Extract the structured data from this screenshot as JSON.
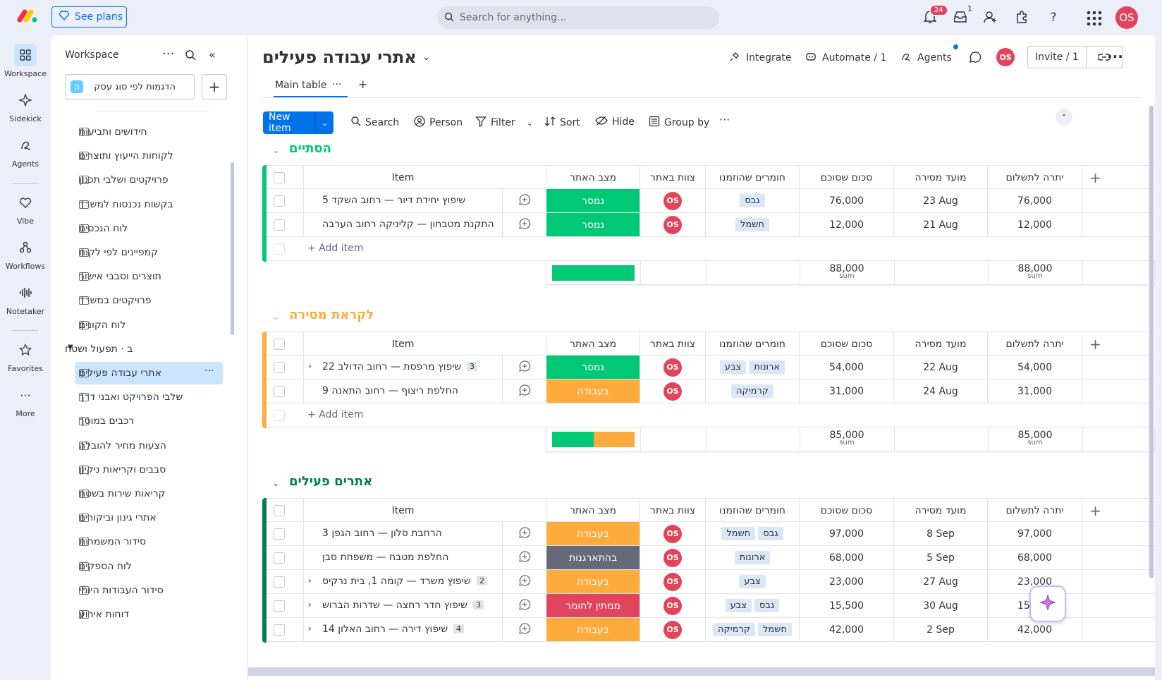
{
  "topbar": {
    "see_plans": "See plans",
    "search_placeholder": "Search for anything...",
    "notifications_count": "24",
    "inbox_count": "1",
    "user_initials": "OS"
  },
  "rail": [
    {
      "label": "Workspace",
      "icon": "grid-icon"
    },
    {
      "label": "Sidekick",
      "icon": "sparkle-icon"
    },
    {
      "label": "Agents",
      "icon": "agents-icon"
    },
    {
      "label": "Vibe",
      "icon": "heart-icon"
    },
    {
      "label": "Workflows",
      "icon": "workflows-icon"
    },
    {
      "label": "Notetaker",
      "icon": "waveform-icon"
    },
    {
      "label": "Favorites",
      "icon": "star-icon"
    },
    {
      "label": "More",
      "icon": "more-icon"
    }
  ],
  "workspace": {
    "title": "Workspace",
    "selector_label": "הדגמות לפי סוג עסק",
    "selector_badge": "ה",
    "folder_label": "ב · תפעול ושטח",
    "items_top": [
      "חידושים ותביעות",
      "לקוחות הייעוץ ותוצרים",
      "פרויקטים ושלבי תכנון",
      "בקשות נכנסות למשרד",
      "לוח הנכסים",
      "קמפיינים לפי לקוח",
      "תוצרים וסבבי אישור",
      "פרויקטים במשרד",
      "לוח הקונים"
    ],
    "active_item": "אתרי עבודה פעילים",
    "items_bottom": [
      "שלבי הפרויקט ואבני דרך",
      "רכבים במוסך",
      "הצעות מחיר להובלה",
      "סבבים וקריאות ניקיון",
      "קריאות שירות בשטח",
      "אתרי גינון וביקורים",
      "סידור המשמרות",
      "לוח הספקים",
      "סידור העבודות היומי",
      "דוחות אירוע"
    ]
  },
  "board": {
    "title": "אתרי עבודה פעילים",
    "integrate": "Integrate",
    "automate": "Automate / 1",
    "agents": "Agents",
    "invite": "Invite / 1",
    "tab_main": "Main table",
    "toolbar": {
      "new_item": "New item",
      "search": "Search",
      "person": "Person",
      "filter": "Filter",
      "sort": "Sort",
      "hide": "Hide",
      "group_by": "Group by"
    },
    "columns": {
      "item": "Item",
      "status": "מצב האתר",
      "team": "צוות באתר",
      "materials": "חומרים שהוזמנו",
      "amount": "סכום שסוכם",
      "due": "מועד מסירה",
      "balance": "יתרה לתשלום"
    },
    "add_item": "+ Add item",
    "sum_label": "sum",
    "groups": [
      {
        "title": "הסתיים",
        "color": "#00c875",
        "rows": [
          {
            "name": "שיפוץ יחידת דיור — רחוב השקד 5",
            "sub": "",
            "status": "נמסר",
            "status_color": "#00c875",
            "team": "OS",
            "materials": [
              "גבס"
            ],
            "amount": "76,000",
            "due": "23 Aug",
            "balance": "76,000"
          },
          {
            "name": "התקנת מטבחון — קליניקה רחוב הערבה",
            "sub": "",
            "status": "נמסר",
            "status_color": "#00c875",
            "team": "OS",
            "materials": [
              "חשמל"
            ],
            "amount": "12,000",
            "due": "21 Aug",
            "balance": "12,000"
          }
        ],
        "sum_amount": "88,000",
        "sum_balance": "88,000",
        "bar": [
          {
            "color": "#00c875",
            "fraction": 1.0
          }
        ]
      },
      {
        "title": "לקראת מסירה",
        "color": "#fdab3d",
        "rows": [
          {
            "name": "שיפוץ מרפסת — רחוב הדולב 22",
            "sub": "3",
            "status": "נמסר",
            "status_color": "#00c875",
            "team": "OS",
            "materials": [
              "ארונות",
              "צבע"
            ],
            "amount": "54,000",
            "due": "22 Aug",
            "balance": "54,000"
          },
          {
            "name": "החלפת ריצוף — רחוב התאנה 9",
            "sub": "",
            "status": "בעבודה",
            "status_color": "#fdab3d",
            "team": "OS",
            "materials": [
              "קרמיקה"
            ],
            "amount": "31,000",
            "due": "24 Aug",
            "balance": "31,000"
          }
        ],
        "sum_amount": "85,000",
        "sum_balance": "85,000",
        "bar": [
          {
            "color": "#00c875",
            "fraction": 0.5
          },
          {
            "color": "#fdab3d",
            "fraction": 0.5
          }
        ]
      },
      {
        "title": "אתרים פעילים",
        "color": "#037f4c",
        "rows": [
          {
            "name": "הרחבת סלון — רחוב הגפן 3",
            "sub": "",
            "status": "בעבודה",
            "status_color": "#fdab3d",
            "team": "OS",
            "materials": [
              "גבס",
              "חשמל"
            ],
            "amount": "97,000",
            "due": "8 Sep",
            "balance": "97,000"
          },
          {
            "name": "החלפת מטבח — משפחת סבן",
            "sub": "",
            "status": "בהתארגנות",
            "status_color": "#676879",
            "team": "OS",
            "materials": [
              "ארונות"
            ],
            "amount": "68,000",
            "due": "5 Sep",
            "balance": "68,000"
          },
          {
            "name": "שיפוץ משרד — קומה 1, בית נרקיס",
            "sub": "2",
            "status": "בעבודה",
            "status_color": "#fdab3d",
            "team": "OS",
            "materials": [
              "צבע"
            ],
            "amount": "23,000",
            "due": "27 Aug",
            "balance": "23,000"
          },
          {
            "name": "שיפוץ חדר רחצה — שדרות הברוש",
            "sub": "3",
            "status": "ממתין לחומר",
            "status_color": "#e2445c",
            "team": "OS",
            "materials": [
              "גבס",
              "צבע"
            ],
            "amount": "15,500",
            "due": "30 Aug",
            "balance": "15,500"
          },
          {
            "name": "שיפוץ דירה — רחוב האלון 14",
            "sub": "4",
            "status": "בעבודה",
            "status_color": "#fdab3d",
            "team": "OS",
            "materials": [
              "חשמל",
              "קרמיקה"
            ],
            "amount": "42,000",
            "due": "2 Sep",
            "balance": "42,000"
          }
        ]
      }
    ]
  }
}
